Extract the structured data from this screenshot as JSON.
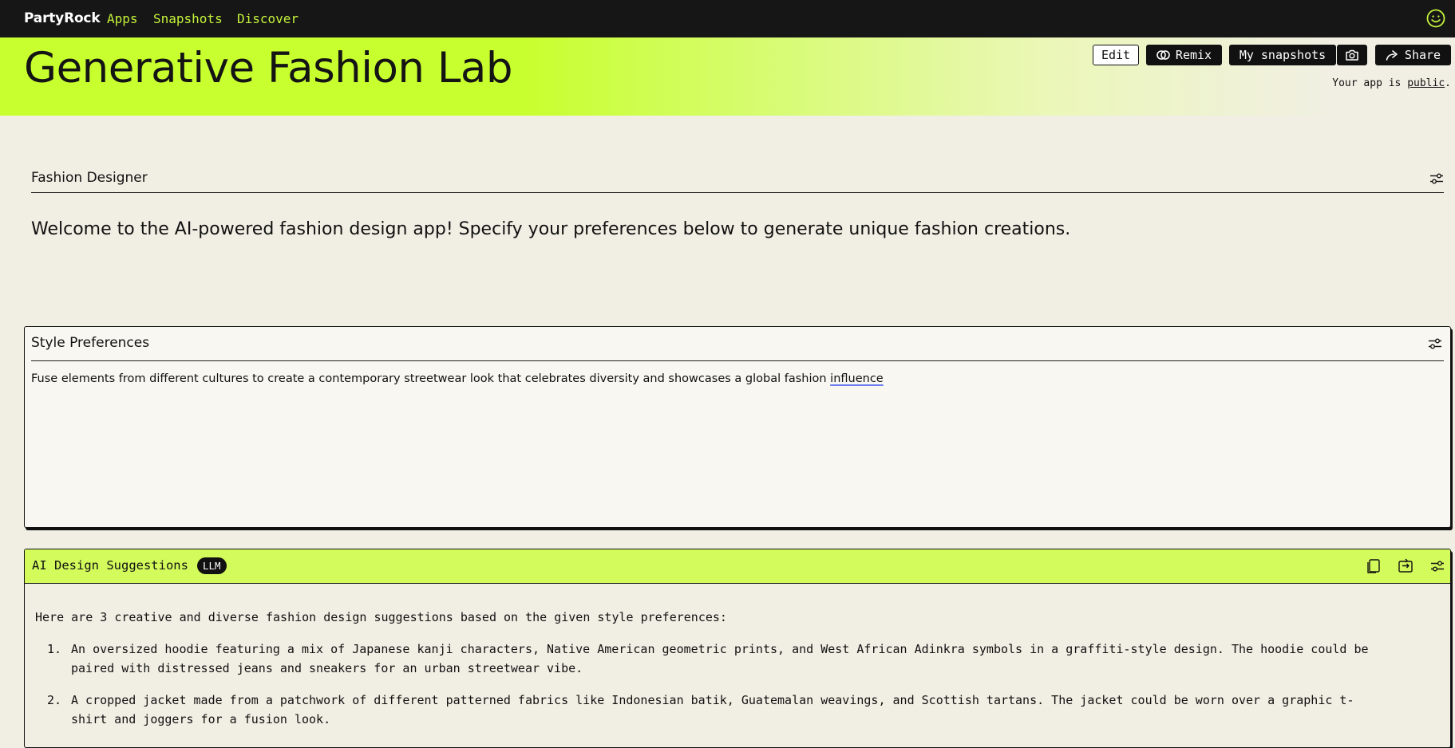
{
  "nav": {
    "brand": "PartyRock",
    "links": [
      "Apps",
      "Snapshots",
      "Discover"
    ],
    "accent_color": "#c4f23a"
  },
  "header": {
    "title": "Generative Fashion Lab",
    "buttons": {
      "edit": "Edit",
      "remix": "Remix",
      "my_snapshots": "My snapshots",
      "share": "Share"
    },
    "visibility_prefix": "Your app is",
    "visibility_link": "public",
    "visibility_suffix": ".",
    "brand_color": "#c8ff2e"
  },
  "designer": {
    "title": "Fashion Designer",
    "welcome": "Welcome to the AI-powered fashion design app! Specify your preferences below to generate unique fashion creations."
  },
  "style_preferences": {
    "title": "Style Preferences",
    "value_main": "Fuse elements from different cultures to create a contemporary streetwear look that celebrates diversity and showcases a global fashion ",
    "value_last_word": "influence"
  },
  "ai_suggestions": {
    "title": "AI Design Suggestions",
    "badge": "LLM",
    "intro": "Here are 3 creative and diverse fashion design suggestions based on the given style preferences:",
    "items": [
      {
        "num": "1.",
        "line1": "An oversized hoodie featuring a mix of Japanese kanji characters, Native American geometric prints, and West African Adinkra symbols in a graffiti-style design. The hoodie could be",
        "line2": "paired with distressed jeans and sneakers for an urban streetwear vibe."
      },
      {
        "num": "2.",
        "line1": "A cropped jacket made from a patchwork of different patterned fabrics like Indonesian batik, Guatemalan weavings, and Scottish tartans. The jacket could be worn over a graphic t-",
        "line2": "shirt and joggers for a fusion look."
      }
    ]
  }
}
